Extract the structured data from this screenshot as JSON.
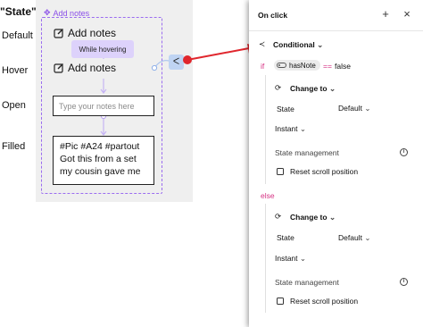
{
  "canvas": {
    "title": "\"State\"",
    "component_tag": "Add notes",
    "states": [
      "Default",
      "Hover",
      "Open",
      "Filled"
    ],
    "note_label": "Add notes",
    "hover_tag": "While hovering",
    "input_placeholder": "Type your notes here",
    "filled_lines": [
      "#Pic #A24 #partout",
      "Got this from a set",
      "my cousin gave me"
    ],
    "accent_color": "#8a4fe8",
    "arrow_color": "#e0262d"
  },
  "panel": {
    "title": "On click",
    "add_icon": "+",
    "close_icon": "×",
    "action": "Conditional",
    "if_keyword": "if",
    "variable": "hasNote",
    "operator": "==",
    "value": "false",
    "else_keyword": "else",
    "branches": [
      {
        "action": "Change to",
        "state_label": "State",
        "state_value": "Default",
        "transition": "Instant",
        "section": "State management",
        "checkbox": "Reset scroll position"
      },
      {
        "action": "Change to",
        "state_label": "State",
        "state_value": "Default",
        "transition": "Instant",
        "section": "State management",
        "checkbox": "Reset scroll position"
      }
    ]
  }
}
